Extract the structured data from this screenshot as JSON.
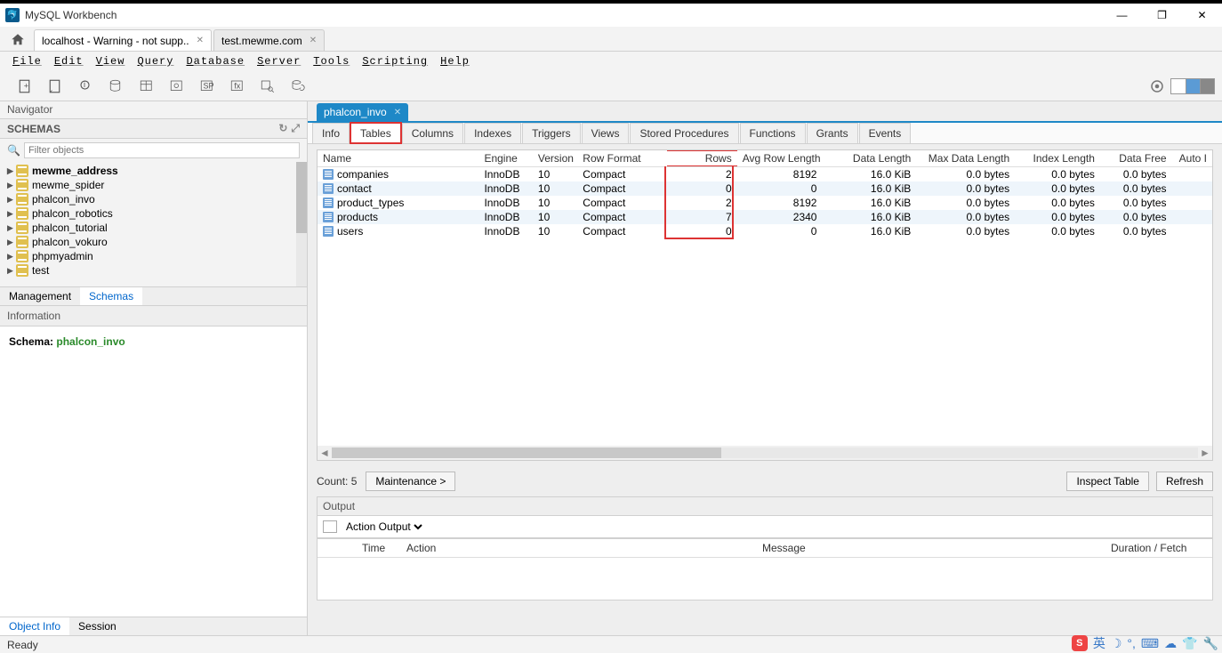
{
  "app_title": "MySQL Workbench",
  "window_buttons": {
    "min": "—",
    "max": "❐",
    "close": "✕"
  },
  "conn_tabs": [
    "localhost - Warning - not supp..",
    "test.mewme.com"
  ],
  "menubar": [
    "File",
    "Edit",
    "View",
    "Query",
    "Database",
    "Server",
    "Tools",
    "Scripting",
    "Help"
  ],
  "sidebar": {
    "navigator": "Navigator",
    "schemas_head": "SCHEMAS",
    "filter_placeholder": "Filter objects",
    "tree": [
      {
        "name": "mewme_address",
        "bold": true
      },
      {
        "name": "mewme_spider"
      },
      {
        "name": "phalcon_invo"
      },
      {
        "name": "phalcon_robotics"
      },
      {
        "name": "phalcon_tutorial"
      },
      {
        "name": "phalcon_vokuro"
      },
      {
        "name": "phpmyadmin"
      },
      {
        "name": "test"
      }
    ],
    "side_tabs": {
      "management": "Management",
      "schemas": "Schemas"
    },
    "information": "Information",
    "schema_label": "Schema: ",
    "schema_value": "phalcon_invo",
    "bottom_tabs": {
      "obj": "Object Info",
      "session": "Session"
    }
  },
  "sqltab": "phalcon_invo",
  "subtabs": [
    "Info",
    "Tables",
    "Columns",
    "Indexes",
    "Triggers",
    "Views",
    "Stored Procedures",
    "Functions",
    "Grants",
    "Events"
  ],
  "grid": {
    "headers": [
      "Name",
      "Engine",
      "Version",
      "Row Format",
      "Rows",
      "Avg Row Length",
      "Data Length",
      "Max Data Length",
      "Index Length",
      "Data Free",
      "Auto I"
    ],
    "rows": [
      {
        "name": "companies",
        "engine": "InnoDB",
        "version": "10",
        "rowfmt": "Compact",
        "rows": "2",
        "avg": "8192",
        "datalen": "16.0 KiB",
        "maxlen": "0.0 bytes",
        "idxlen": "0.0 bytes",
        "free": "0.0 bytes"
      },
      {
        "name": "contact",
        "engine": "InnoDB",
        "version": "10",
        "rowfmt": "Compact",
        "rows": "0",
        "avg": "0",
        "datalen": "16.0 KiB",
        "maxlen": "0.0 bytes",
        "idxlen": "0.0 bytes",
        "free": "0.0 bytes"
      },
      {
        "name": "product_types",
        "engine": "InnoDB",
        "version": "10",
        "rowfmt": "Compact",
        "rows": "2",
        "avg": "8192",
        "datalen": "16.0 KiB",
        "maxlen": "0.0 bytes",
        "idxlen": "0.0 bytes",
        "free": "0.0 bytes"
      },
      {
        "name": "products",
        "engine": "InnoDB",
        "version": "10",
        "rowfmt": "Compact",
        "rows": "7",
        "avg": "2340",
        "datalen": "16.0 KiB",
        "maxlen": "0.0 bytes",
        "idxlen": "0.0 bytes",
        "free": "0.0 bytes"
      },
      {
        "name": "users",
        "engine": "InnoDB",
        "version": "10",
        "rowfmt": "Compact",
        "rows": "0",
        "avg": "0",
        "datalen": "16.0 KiB",
        "maxlen": "0.0 bytes",
        "idxlen": "0.0 bytes",
        "free": "0.0 bytes"
      }
    ]
  },
  "footer": {
    "count": "Count: 5",
    "maint": "Maintenance >",
    "inspect": "Inspect Table",
    "refresh": "Refresh"
  },
  "output": {
    "head": "Output",
    "selector": "Action Output",
    "cols": {
      "time": "Time",
      "action": "Action",
      "message": "Message",
      "duration": "Duration / Fetch"
    }
  },
  "status": "Ready",
  "tray_letters": {
    "s": "S",
    "zh": "英"
  }
}
